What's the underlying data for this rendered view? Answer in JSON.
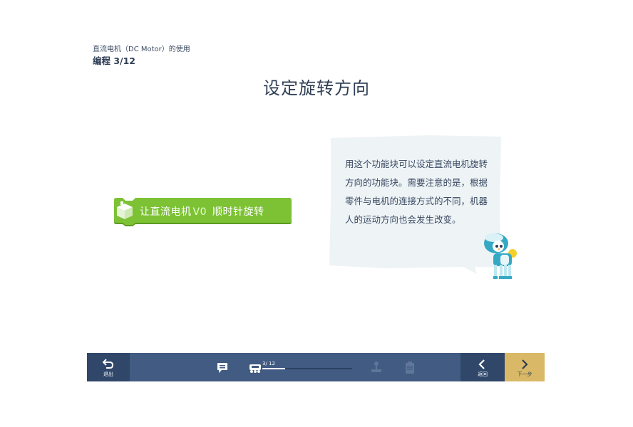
{
  "header": {
    "lesson_subtitle": "直流电机（DC Motor）的使用",
    "lesson_step": "编程 3/12"
  },
  "page_title": "设定旋转方向",
  "code_block": {
    "label_prefix": "让直流电机",
    "motor_port": "V0",
    "direction": "顺时针旋转",
    "color": "#7cc234"
  },
  "description": {
    "text": "用这个功能块可以设定直流电机旋转方向的功能块。需要注意的是，根据零件与电机的连接方式的不同，机器人的运动方向也会发生改变。"
  },
  "toolbar": {
    "exit_label": "退出",
    "progress_label": "3/ 12",
    "progress_fraction": 0.25,
    "back_label": "返回",
    "next_label": "下一步",
    "icons": [
      "undo-arrow-icon",
      "chat-icon",
      "robot-icon",
      "joystick-icon",
      "clipboard-icon",
      "chevron-left-icon",
      "chevron-right-icon"
    ],
    "colors": {
      "bar": "#415b82",
      "dark": "#30476a",
      "next": "#d9b968"
    }
  }
}
